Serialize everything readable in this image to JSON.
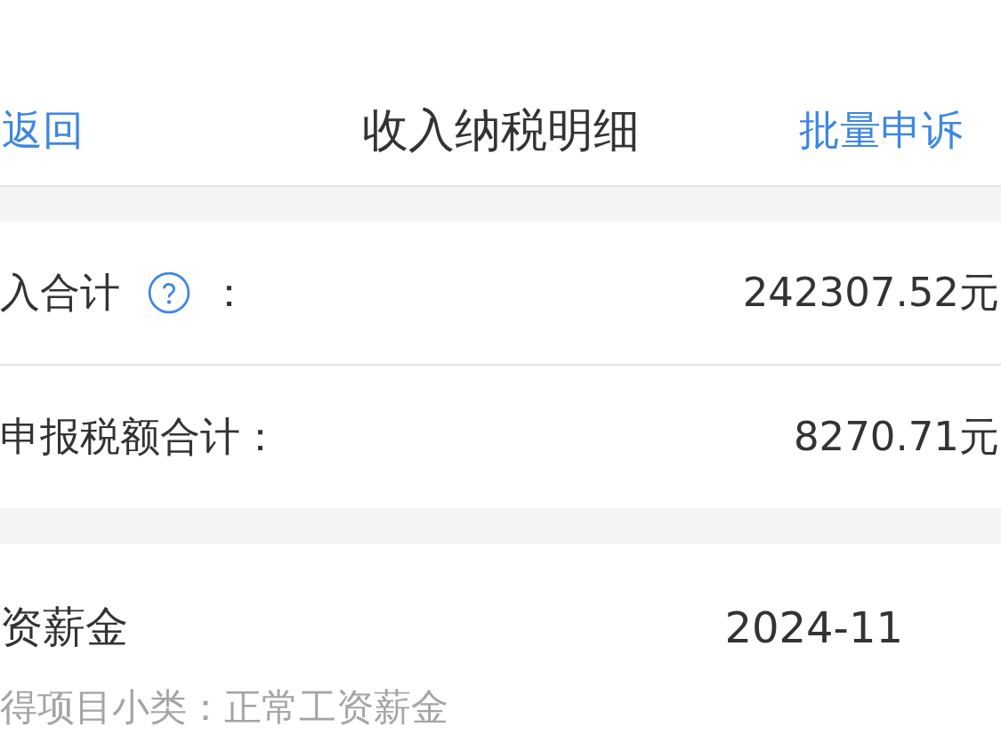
{
  "nav": {
    "back": "返回",
    "title": "收入纳税明细",
    "action": "批量申诉"
  },
  "summary": [
    {
      "label": "入合计",
      "help": true,
      "colon": "：",
      "value": "242307.52元"
    },
    {
      "label": "申报税额合计：",
      "value": "8270.71元"
    }
  ],
  "records": [
    {
      "title": "资薪金",
      "date": "2024-11",
      "subtitle": "得项目小类：正常工资薪金"
    }
  ]
}
